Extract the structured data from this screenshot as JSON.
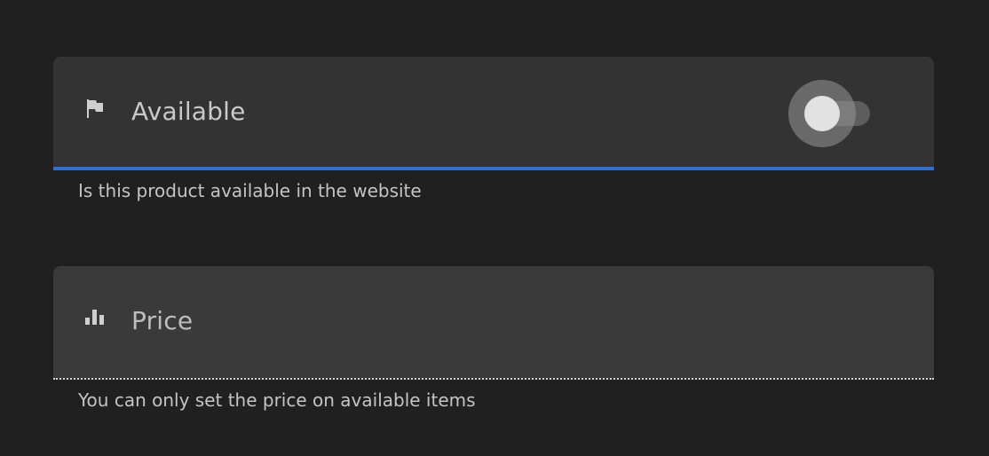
{
  "available": {
    "label": "Available",
    "icon": "flag-icon",
    "toggle_on": false,
    "helper": "Is this product available in the website",
    "accent_color": "#2f6fd6"
  },
  "price": {
    "label": "Price",
    "icon": "bar-chart-icon",
    "value": "",
    "disabled": true,
    "helper": "You can only set the price on available items"
  }
}
